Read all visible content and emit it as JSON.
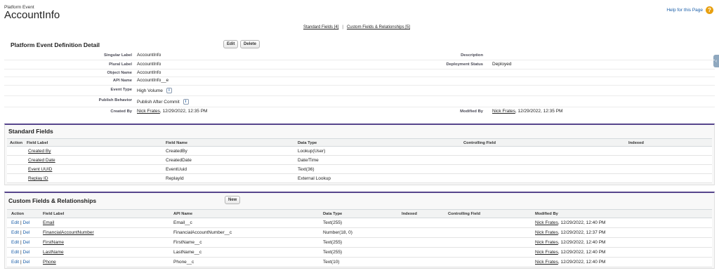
{
  "header": {
    "object_type": "Platform Event",
    "title": "AccountInfo",
    "help_label": "Help for this Page"
  },
  "anchors": {
    "standard": "Standard Fields [4]",
    "separator": "|",
    "custom": "Custom Fields & Relationships [5]"
  },
  "detail": {
    "title": "Platform Event Definition Detail",
    "edit_label": "Edit",
    "delete_label": "Delete",
    "fields": {
      "singular_label": {
        "label": "Singular Label",
        "value": "AccountInfo"
      },
      "plural_label": {
        "label": "Plural Label",
        "value": "AccountInfo"
      },
      "object_name": {
        "label": "Object Name",
        "value": "AccountInfo"
      },
      "api_name": {
        "label": "API Name",
        "value": "AccountInfo__e"
      },
      "event_type": {
        "label": "Event Type",
        "value": "High Volume"
      },
      "publish_behavior": {
        "label": "Publish Behavior",
        "value": "Publish After Commit"
      },
      "created_by": {
        "label": "Created By",
        "user": "Nick Frates",
        "date": ", 12/29/2022, 12:35 PM"
      },
      "description": {
        "label": "Description",
        "value": ""
      },
      "deployment_status": {
        "label": "Deployment Status",
        "value": "Deployed"
      },
      "modified_by": {
        "label": "Modified By",
        "user": "Nick Frates",
        "date": ", 12/29/2022, 12:35 PM"
      }
    }
  },
  "standard_fields": {
    "title": "Standard Fields",
    "columns": [
      "Action",
      "Field Label",
      "Field Name",
      "Data Type",
      "Controlling Field",
      "Indexed"
    ],
    "rows": [
      {
        "label": "Created By",
        "name": "CreatedBy",
        "type": "Lookup(User)"
      },
      {
        "label": "Created Date",
        "name": "CreatedDate",
        "type": "Date/Time"
      },
      {
        "label": "Event UUID",
        "name": "EventUuid",
        "type": "Text(36)"
      },
      {
        "label": "Replay ID",
        "name": "ReplayId",
        "type": "External Lookup"
      }
    ]
  },
  "custom_fields": {
    "title": "Custom Fields & Relationships",
    "new_label": "New",
    "columns": [
      "Action",
      "Field Label",
      "API Name",
      "Data Type",
      "Indexed",
      "Controlling Field",
      "Modified By"
    ],
    "edit_label": "Edit",
    "action_sep": "|",
    "del_label": "Del",
    "rows": [
      {
        "label": "Email",
        "api": "Email__c",
        "type": "Text(255)",
        "user": "Nick Frates",
        "date": ", 12/29/2022, 12:40 PM"
      },
      {
        "label": "FinancialAccountNumber",
        "api": "FinancialAccountNumber__c",
        "type": "Number(18, 0)",
        "user": "Nick Frates",
        "date": ", 12/29/2022, 12:37 PM"
      },
      {
        "label": "FirstName",
        "api": "FirstName__c",
        "type": "Text(255)",
        "user": "Nick Frates",
        "date": ", 12/29/2022, 12:40 PM"
      },
      {
        "label": "LastName",
        "api": "LastName__c",
        "type": "Text(255)",
        "user": "Nick Frates",
        "date": ", 12/29/2022, 12:40 PM"
      },
      {
        "label": "Phone",
        "api": "Phone__c",
        "type": "Text(10)",
        "user": "Nick Frates",
        "date": ", 12/29/2022, 12:40 PM"
      }
    ]
  },
  "icons": {
    "help": "help-icon",
    "info": "info-icon",
    "side_tab": "collapse-arrow-icon"
  },
  "colors": {
    "section_accent": "#56458c",
    "link_blue": "#1a5ea8",
    "help_orange": "#e8a010"
  }
}
